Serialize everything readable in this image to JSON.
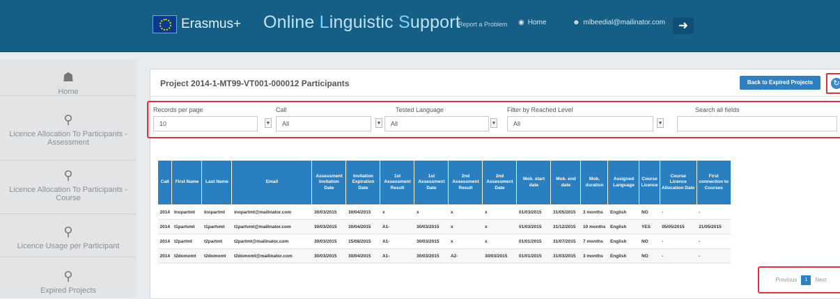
{
  "header": {
    "brand": "Erasmus+",
    "ols_parts": [
      {
        "cap": "",
        "text": "Online "
      },
      {
        "cap": "L",
        "text": "inguistic "
      },
      {
        "cap": "S",
        "text": "upport"
      }
    ],
    "report": "Report a Problem",
    "home": "Home",
    "user": "mlbeedial@mailinator.com"
  },
  "sidebar": {
    "items": [
      {
        "label": "Home",
        "icon": "home-icon"
      },
      {
        "label": "Licence Allocation To Participants - Assessment",
        "icon": "pin-icon"
      },
      {
        "label": "Licence Allocation To Participants - Course",
        "icon": "pin-icon"
      },
      {
        "label": "Licence Usage per Participant",
        "icon": "pin-icon"
      },
      {
        "label": "Expired Projects",
        "icon": "pin-icon"
      }
    ]
  },
  "panel": {
    "title": "Project 2014-1-MT99-VT001-000012 Participants",
    "back_button": "Back to Expired Projects"
  },
  "filters": {
    "records_label": "Records per page",
    "records_value": "10",
    "call_label": "Call",
    "call_value": "All",
    "tested_label": "Tested Language",
    "tested_value": "All",
    "level_label": "Filter by Reached Level",
    "level_value": "All",
    "search_label": "Search all fields",
    "search_value": ""
  },
  "table": {
    "headers": [
      "Call",
      "First Name",
      "Last Name",
      "Email",
      "Assessment Invitation Date",
      "Invitation Expiration Date",
      "1st Assessment Result",
      "1st Assessment Date",
      "2nd Assessment Result",
      "2nd Assessment Date",
      "Mob. start date",
      "Mob. end date",
      "Mob. duration",
      "Assigned Language",
      "Course Licence",
      "Course Licence Allocation Date",
      "First connection to Courses"
    ],
    "rows": [
      [
        "2014",
        "Inopartmt",
        "Inopartmt",
        "inopartmt@mailinator.com",
        "30/03/2015",
        "30/04/2015",
        "x",
        "x",
        "x",
        "x",
        "01/03/2015",
        "31/05/2015",
        "3 months",
        "English",
        "NO",
        "-",
        "-"
      ],
      [
        "2014",
        "t1partvmt",
        "t1partvmt",
        "t1partvmt@mailinator.com",
        "30/03/2015",
        "30/04/2015",
        "A1-",
        "30/03/2015",
        "x",
        "x",
        "01/03/2015",
        "31/12/2015",
        "10 months",
        "English",
        "YES",
        "05/05/2015",
        "21/05/2015"
      ],
      [
        "2014",
        "t2partmt",
        "t2partmt",
        "t2partmt@mailinator.com",
        "30/03/2015",
        "15/08/2015",
        "A1-",
        "30/03/2015",
        "x",
        "x",
        "01/01/2015",
        "31/07/2015",
        "7 months",
        "English",
        "NO",
        "-",
        "-"
      ],
      [
        "2014",
        "t2domomt",
        "t2domomt",
        "t2domomt@mailinator.com",
        "30/03/2015",
        "30/04/2015",
        "A1-",
        "30/03/2015",
        "A2-",
        "30/03/2015",
        "01/01/2015",
        "31/03/2015",
        "3 months",
        "English",
        "NO",
        "-",
        "-"
      ]
    ]
  },
  "pagination": {
    "previous": "Previous",
    "page": "1",
    "next": "Next"
  }
}
